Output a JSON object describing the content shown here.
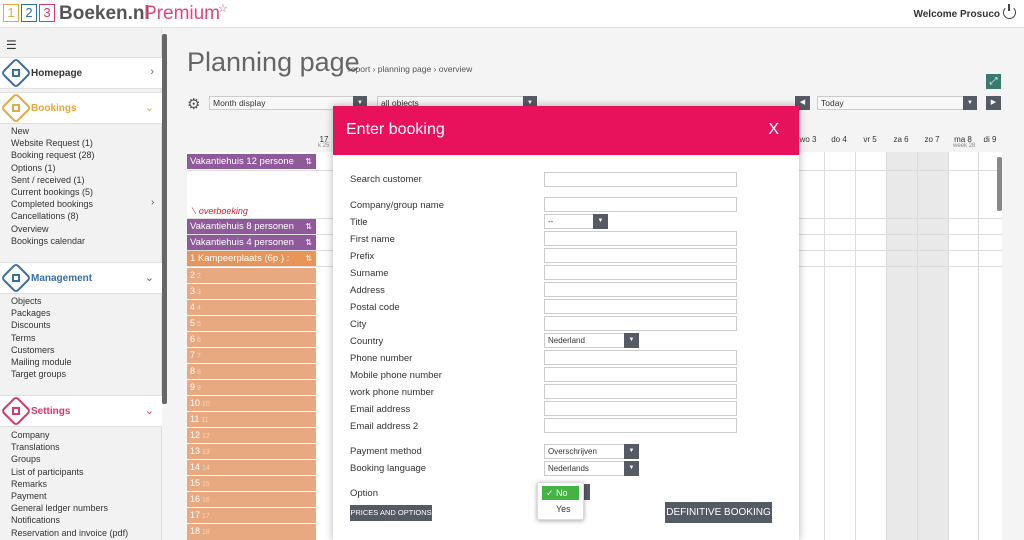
{
  "logo": {
    "d1": "1",
    "d2": "2",
    "d3": "3",
    "c1": "#e5a740",
    "c2": "#2b6fb0",
    "c3": "#d9386a",
    "brand": "Boeken.nl",
    "premium": "Premium",
    "star": "☆"
  },
  "header": {
    "welcome": "Welcome Prosuco"
  },
  "sidebar": {
    "menu_icon": "☰",
    "homepage": {
      "label": "Homepage",
      "icon": "house-icon",
      "color": "#3a6fa5"
    },
    "bookings": {
      "label": "Bookings",
      "icon": "bookings-icon",
      "color": "#e5a740",
      "items": [
        "New",
        "Website Request (1)",
        "Booking request (28)",
        "Options (1)",
        "Sent / received (1)",
        "Current bookings (5)",
        "Completed bookings",
        "Cancellations (8)",
        "Overview",
        "Bookings calendar"
      ]
    },
    "management": {
      "label": "Management",
      "icon": "grid-icon",
      "color": "#3a6fa5",
      "items": [
        "Objects",
        "Packages",
        "Discounts",
        "Terms",
        "Customers",
        "Mailing module",
        "Target groups"
      ]
    },
    "settings": {
      "label": "Settings",
      "icon": "settings-icon",
      "color": "#d9386a",
      "items": [
        "Company",
        "Translations",
        "Groups",
        "List of participants",
        "Remarks",
        "Payment",
        "General ledger numbers",
        "Notifications",
        "Reservation and invoice (pdf)"
      ]
    }
  },
  "page": {
    "title": "Planning page",
    "breadcrumb": "report › planning page › overview"
  },
  "toolbar": {
    "display": "Month display",
    "objects": "all objects",
    "date": "Today"
  },
  "calendar": {
    "day_17": "17",
    "week_left": "k 25",
    "days": [
      "wo 3",
      "do 4",
      "vr 5",
      "za 6",
      "zo 7",
      "ma 8",
      "di 9"
    ],
    "week_right": "week 28",
    "overbooking": "overboeking",
    "rows": [
      {
        "label": "Vakantiehuis 12 persone",
        "icon": "⇅"
      },
      {
        "label": "Vakantiehuis 8 personen",
        "icon": "⇅"
      },
      {
        "label": "Vakantiehuis 4 personen",
        "icon": "⇅"
      },
      {
        "label": "1 Kampeerplaats (6p.) :",
        "icon": "⇅"
      }
    ],
    "numbered": [
      "2",
      "3",
      "4",
      "5",
      "6",
      "7",
      "8",
      "9",
      "10",
      "11",
      "12",
      "13",
      "14",
      "15",
      "16",
      "17",
      "18"
    ]
  },
  "modal": {
    "title": "Enter booking",
    "close": "X",
    "fields": {
      "search_customer": "Search customer",
      "company": "Company/group name",
      "title": "Title",
      "first_name": "First name",
      "prefix": "Prefix",
      "surname": "Surname",
      "address": "Address",
      "postal": "Postal code",
      "city": "City",
      "country": "Country",
      "phone": "Phone number",
      "mobile": "Mobile phone number",
      "work": "work phone number",
      "email": "Email address",
      "email2": "Email address 2",
      "payment": "Payment method",
      "language": "Booking language",
      "option": "Option"
    },
    "values": {
      "title": "--",
      "country": "Nederland",
      "payment": "Overschrijven",
      "language": "Nederlands"
    },
    "option_no": "✓ No",
    "option_yes": "Yes",
    "prices_button": "PRICES AND OPTIONS",
    "definitive_button": "DEFINITIVE BOOKING"
  }
}
